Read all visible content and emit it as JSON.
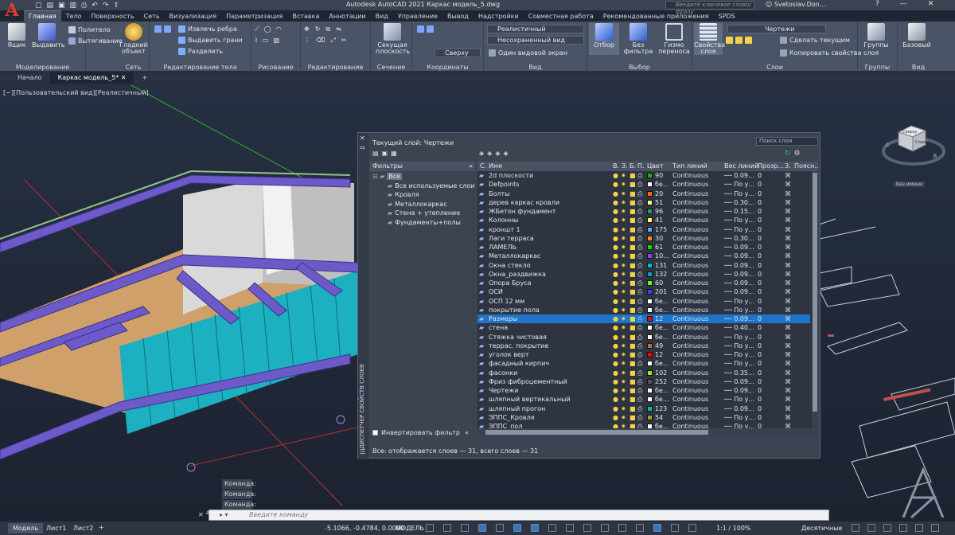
{
  "window": {
    "title": "Autodesk AutoCAD 2021    Каркас модель_5.dwg",
    "search_placeholder": "Введите ключевое слово/фразу",
    "user": "Svetoslav.Don...",
    "qat_icons": [
      "new-icon",
      "open-icon",
      "save-icon",
      "save-as-icon",
      "print-icon",
      "undo-icon",
      "redo-icon",
      "share-icon"
    ]
  },
  "ribbon_tabs": [
    "Главная",
    "Тело",
    "Поверхность",
    "Сеть",
    "Визуализация",
    "Параметризация",
    "Вставка",
    "Аннотации",
    "Вид",
    "Управление",
    "Вывод",
    "Надстройки",
    "Совместная работа",
    "Рекомендованные приложения",
    "SPDS"
  ],
  "ribbon": {
    "modeling": {
      "title": "Моделирование",
      "box": "Ящик",
      "extrude": "Выдавить",
      "polysolid": "Политело",
      "presspull": "Вытягивание"
    },
    "mesh": {
      "title": "Сеть",
      "smooth": "Гладкий объект"
    },
    "solid_edit": {
      "title": "Редактирование тела",
      "extract": "Извлечь ребра",
      "extrude_faces": "Выдавить грани",
      "separate": "Разделить"
    },
    "draw": {
      "title": "Рисование"
    },
    "modify": {
      "title": "Редактирование"
    },
    "section": {
      "title": "Сечение",
      "plane": "Секущая плоскость"
    },
    "coords": {
      "title": "Координаты",
      "view_combo": "Сверху"
    },
    "view": {
      "title": "Вид",
      "visual_style": "Реалистичный",
      "projection": "Несохраненный вид",
      "single": "Один видовой экран"
    },
    "selection": {
      "title": "Выбор",
      "select": "Отбор",
      "nofilter": "Без фильтра",
      "gizmo": "Гизмо переноса"
    },
    "layers": {
      "title": "Слои",
      "props": "Свойства слоя",
      "layer_combo": "Чертежи",
      "make_current": "Сделать текущим",
      "match": "Копировать свойства слоя"
    },
    "groups": {
      "title": "Группы",
      "groups": "Группы"
    },
    "view2": {
      "title": "Вид",
      "base": "Базовый"
    }
  },
  "doc_tabs": [
    "Начало",
    "Каркас модель_5*"
  ],
  "viewport_label": "[−][Пользовательский вид][Реалистичный]",
  "viewcube": {
    "top": "Сверху",
    "right": "Справа",
    "north": "С",
    "east": "В",
    "south": "Ю",
    "wcs": "Без имени"
  },
  "layer_panel": {
    "current": "Текущий слой: Чертежи",
    "search": "Поиск слоя",
    "filters_title": "Фильтры",
    "filters": [
      "Все",
      "Все используемые слои",
      "Кровля",
      "Металлокаркас",
      "Стена + утепление",
      "Фундаменты+полы"
    ],
    "invert": "Инвертировать фильтр",
    "side_title": "ДИСПЕТЧЕР СВОЙСТВ СЛОЕВ",
    "status": "Все: отображается слоев — 31, всего слоев — 31",
    "columns": [
      "С.",
      "Имя",
      "В.",
      "З.",
      "Б.",
      "П.",
      "Цвет",
      "Тип линий",
      "Вес линий",
      "Прозр...",
      "З.",
      "Поясн..."
    ],
    "rows": [
      {
        "name": "2d плоскости",
        "color": "#00c000",
        "cnum": "90",
        "lw": "0.09...",
        "tr": "0"
      },
      {
        "name": "Defpoints",
        "color": "#ffffff",
        "cnum": "бе...",
        "lw": "По у...",
        "tr": "0"
      },
      {
        "name": "Болты",
        "color": "#ff6a00",
        "cnum": "20",
        "lw": "По у...",
        "tr": "0"
      },
      {
        "name": "дерев каркас кровли",
        "color": "#ffff7f",
        "cnum": "51",
        "lw": "0.30...",
        "tr": "0"
      },
      {
        "name": "ЖБетон фундамент",
        "color": "#20a060",
        "cnum": "96",
        "lw": "0.15...",
        "tr": "0"
      },
      {
        "name": "Колонны",
        "color": "#ffff60",
        "cnum": "41",
        "lw": "По у...",
        "tr": "0"
      },
      {
        "name": "кроншт 1",
        "color": "#6aa0ff",
        "cnum": "175",
        "lw": "По у...",
        "tr": "0"
      },
      {
        "name": "Лаги терраса",
        "color": "#ff8c20",
        "cnum": "30",
        "lw": "0.30...",
        "tr": "0"
      },
      {
        "name": "ЛАМЕЛЬ",
        "color": "#00e000",
        "cnum": "61",
        "lw": "0.09...",
        "tr": "0"
      },
      {
        "name": "Металлокаркас",
        "color": "#9040ff",
        "cnum": "10...",
        "lw": "0.09...",
        "tr": "0"
      },
      {
        "name": "Окна стекло",
        "color": "#00c0c0",
        "cnum": "131",
        "lw": "0.09...",
        "tr": "0"
      },
      {
        "name": "Окна_раздвижка",
        "color": "#00a0c0",
        "cnum": "132",
        "lw": "0.09...",
        "tr": "0"
      },
      {
        "name": "Опора Бруса",
        "color": "#60ff00",
        "cnum": "60",
        "lw": "0.09...",
        "tr": "0"
      },
      {
        "name": "ОСИ",
        "color": "#4040ff",
        "cnum": "201",
        "lw": "0.09...",
        "tr": "0"
      },
      {
        "name": "ОСП 12 мм",
        "color": "#ffffff",
        "cnum": "бе...",
        "lw": "По у...",
        "tr": "0"
      },
      {
        "name": "покрытие пола",
        "color": "#ffffff",
        "cnum": "бе...",
        "lw": "По у...",
        "tr": "0"
      },
      {
        "name": "Размеры",
        "color": "#ff0000",
        "cnum": "12",
        "lw": "0.09...",
        "tr": "0"
      },
      {
        "name": "стена",
        "color": "#ffffff",
        "cnum": "бе...",
        "lw": "0.40...",
        "tr": "0"
      },
      {
        "name": "Стяжка чистовая",
        "color": "#ffffff",
        "cnum": "бе...",
        "lw": "По у...",
        "tr": "0"
      },
      {
        "name": "террас. покрытие",
        "color": "#b07040",
        "cnum": "49",
        "lw": "По у...",
        "tr": "0"
      },
      {
        "name": "уголок верт",
        "color": "#ff0000",
        "cnum": "12",
        "lw": "По у...",
        "tr": "0"
      },
      {
        "name": "фасадный кирпич",
        "color": "#ffffff",
        "cnum": "бе...",
        "lw": "По у...",
        "tr": "0"
      },
      {
        "name": "фасонки",
        "color": "#80ff00",
        "cnum": "102",
        "lw": "0.35...",
        "tr": "0"
      },
      {
        "name": "Фриз фиброцементный",
        "color": "#555555",
        "cnum": "252",
        "lw": "0.09...",
        "tr": "0"
      },
      {
        "name": "Чертежи",
        "color": "#ffffff",
        "cnum": "бе...",
        "lw": "0.09...",
        "tr": "0"
      },
      {
        "name": "шляпный вертикальный",
        "color": "#ffffff",
        "cnum": "бе...",
        "lw": "По у...",
        "tr": "0"
      },
      {
        "name": "шляпный прогон",
        "color": "#00c0a0",
        "cnum": "123",
        "lw": "0.09...",
        "tr": "0"
      },
      {
        "name": "ЭППС_Кровля",
        "color": "#a0a020",
        "cnum": "54",
        "lw": "По у...",
        "tr": "0"
      },
      {
        "name": "ЭППС_пол",
        "color": "#ffffff",
        "cnum": "бе...",
        "lw": "По у...",
        "tr": "0"
      }
    ],
    "linetype": "Continuous",
    "selected_index": 16
  },
  "cmd": {
    "history": [
      "Команда:",
      "Команда:",
      "Команда:"
    ],
    "placeholder": "Введите команду"
  },
  "status": {
    "tabs": [
      "Модель",
      "Лист1",
      "Лист2"
    ],
    "coords": "-5.1066, -0.4784, 0.0000",
    "mode": "МОДЕЛЬ",
    "scale": "1:1 / 100%",
    "units": "Десятичные"
  }
}
